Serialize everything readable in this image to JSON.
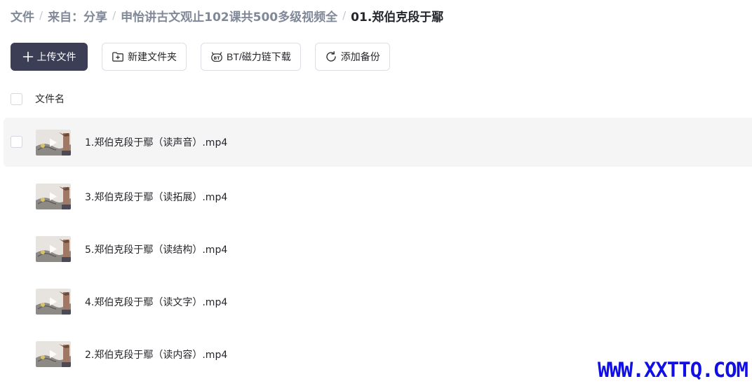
{
  "breadcrumb": [
    {
      "label": "文件"
    },
    {
      "label": "来自：分享"
    },
    {
      "label": "申怡讲古文观止102课共500多级视频全"
    },
    {
      "label": "01.郑伯克段于鄢"
    }
  ],
  "breadcrumb_separator": "/",
  "toolbar": {
    "upload": {
      "label": "上传文件",
      "icon": "plus-icon"
    },
    "new_folder": {
      "label": "新建文件夹",
      "icon": "new-folder-icon"
    },
    "bt_download": {
      "label": "BT/磁力链下载",
      "icon": "bt-icon"
    },
    "add_backup": {
      "label": "添加备份",
      "icon": "refresh-icon"
    }
  },
  "list": {
    "header_label": "文件名",
    "files": [
      {
        "name": "1.郑伯克段于鄢（读声音）.mp4"
      },
      {
        "name": "3.郑伯克段于鄢（读拓展）.mp4"
      },
      {
        "name": "5.郑伯克段于鄢（读结构）.mp4"
      },
      {
        "name": "4.郑伯克段于鄢（读文字）.mp4"
      },
      {
        "name": "2.郑伯克段于鄢（读内容）.mp4"
      }
    ]
  },
  "watermark": "WWW.XXTTQ.COM",
  "colors": {
    "primary_button": "#3b3e54",
    "watermark": "#1010e6",
    "hover_row": "#f5f5f6"
  }
}
